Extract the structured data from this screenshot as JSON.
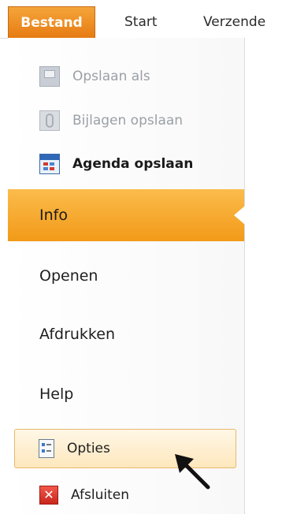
{
  "ribbon": {
    "tabs": [
      {
        "label": "Bestand",
        "active": true
      },
      {
        "label": "Start",
        "active": false
      },
      {
        "label": "Verzende",
        "active": false
      }
    ]
  },
  "backstage": {
    "commands": [
      {
        "label": "Opslaan als",
        "icon": "save-as-icon",
        "enabled": false
      },
      {
        "label": "Bijlagen opslaan",
        "icon": "attachment-icon",
        "enabled": false
      },
      {
        "label": "Agenda opslaan",
        "icon": "calendar-icon",
        "enabled": true
      }
    ],
    "sections": [
      {
        "label": "Info",
        "selected": true
      },
      {
        "label": "Openen",
        "selected": false
      },
      {
        "label": "Afdrukken",
        "selected": false
      },
      {
        "label": "Help",
        "selected": false
      }
    ],
    "bottom_commands": [
      {
        "label": "Opties",
        "icon": "options-icon",
        "hovered": true
      },
      {
        "label": "Afsluiten",
        "icon": "exit-icon",
        "hovered": false
      }
    ],
    "exit_glyph": "✕"
  },
  "colors": {
    "accent_orange": "#f29a18",
    "file_tab": "#e67a12",
    "hover_fill": "#fde7bd",
    "hover_border": "#e9b86a"
  }
}
